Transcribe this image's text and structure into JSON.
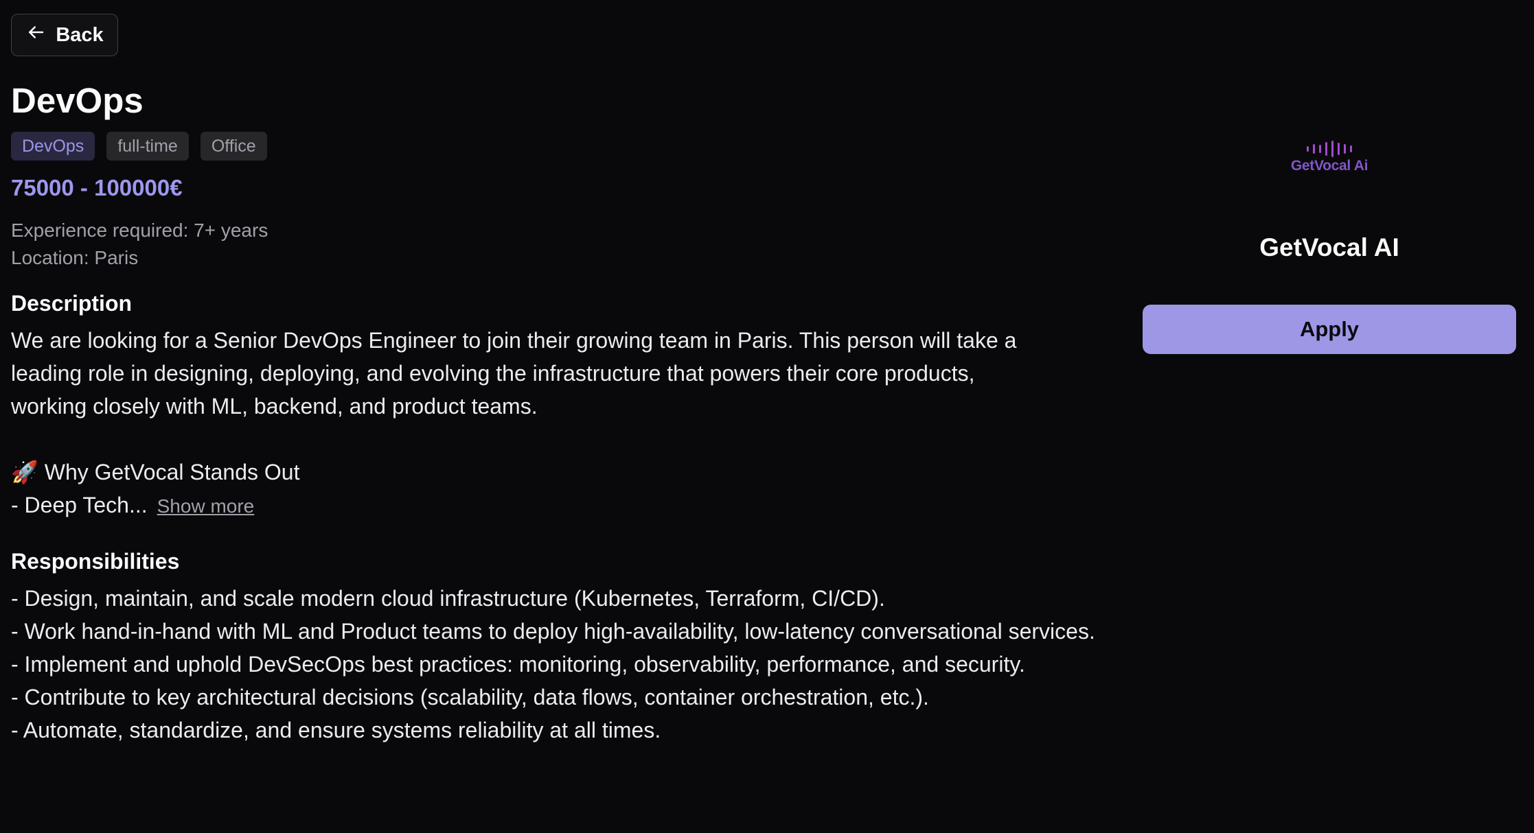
{
  "nav": {
    "back_label": "Back",
    "back_icon": "arrow-left-icon"
  },
  "job": {
    "title": "DevOps",
    "tags": [
      "DevOps",
      "full-time",
      "Office"
    ],
    "salary": "75000 - 100000€",
    "experience": "Experience required: 7+ years",
    "location": "Location: Paris"
  },
  "description": {
    "heading": "Description",
    "text": "We are looking for a Senior DevOps Engineer to join their growing team in Paris. This person will take a\nleading role in designing, deploying, and evolving the infrastructure that powers their core products,\nworking closely with ML, backend, and product teams.",
    "teaser_line1": "🚀 Why GetVocal Stands Out",
    "teaser_line2": "- Deep Tech...",
    "show_more": "Show more"
  },
  "responsibilities": {
    "heading": "Responsibilities",
    "items": [
      "- Design, maintain, and scale modern cloud infrastructure (Kubernetes, Terraform, CI/CD).",
      "- Work hand-in-hand with ML and Product teams to deploy high-availability, low-latency conversational services.",
      "- Implement and uphold DevSecOps best practices: monitoring, observability, performance, and security.",
      "- Contribute to key architectural decisions (scalability, data flows, container orchestration, etc.).",
      "- Automate, standardize, and ensure systems reliability at all times."
    ]
  },
  "company": {
    "logo_text": "GetVocal Ai",
    "name": "GetVocal AI",
    "apply_label": "Apply"
  },
  "colors": {
    "background": "#09090b",
    "accent": "#9d97e6",
    "tag_bg": "#27272a"
  }
}
